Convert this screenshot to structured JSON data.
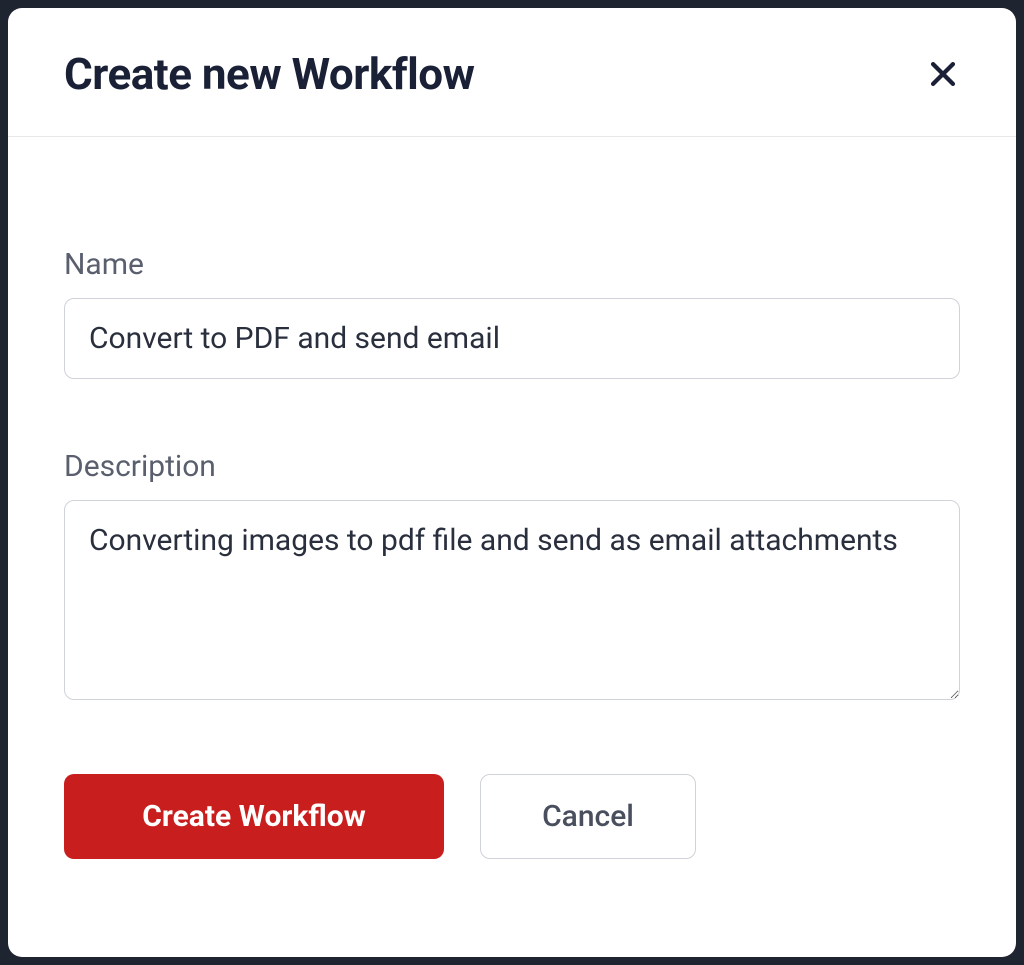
{
  "modal": {
    "title": "Create new Workflow",
    "form": {
      "name": {
        "label": "Name",
        "value": "Convert to PDF and send email"
      },
      "description": {
        "label": "Description",
        "value": "Converting images to pdf file and send as email attachments"
      }
    },
    "actions": {
      "primary": "Create Workflow",
      "secondary": "Cancel"
    }
  }
}
